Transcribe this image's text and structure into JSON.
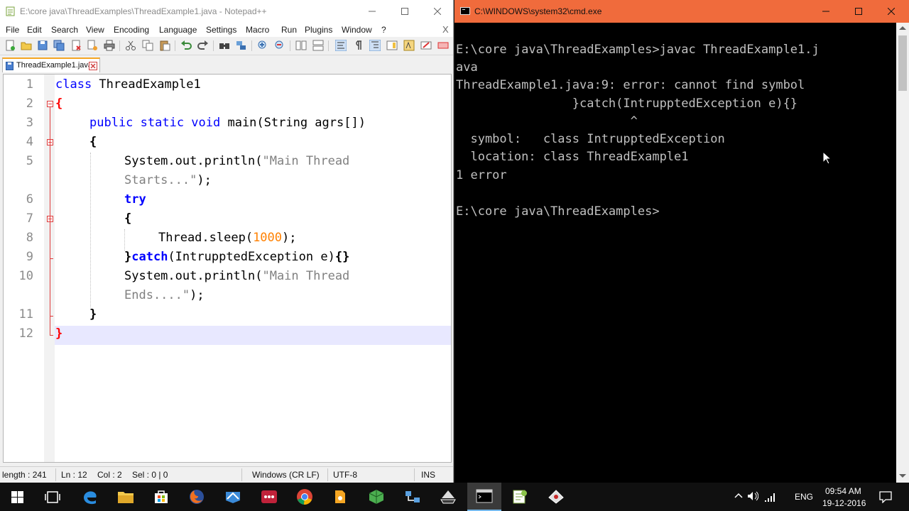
{
  "notepad": {
    "title": "E:\\core java\\ThreadExamples\\ThreadExample1.java - Notepad++",
    "menu": [
      "File",
      "Edit",
      "Search",
      "View",
      "Encoding",
      "Language",
      "Settings",
      "Macro",
      "Run",
      "Plugins",
      "Window",
      "?"
    ],
    "menu_close": "X",
    "tab_label": "ThreadExample1.java",
    "line_numbers": [
      "1",
      "2",
      "3",
      "4",
      "5",
      "6",
      "7",
      "8",
      "9",
      "10",
      "11",
      "12"
    ],
    "code": {
      "l1_kw": "class",
      "l1_name": " ThreadExample1",
      "l2_brace": "{",
      "l3_kw": "public static void",
      "l3_rest": " main(String agrs[])",
      "l4_brace": "{",
      "l5_call": "System.out.println(",
      "l5_str": "\"Main Thread",
      "l5b_str": "Starts...\"",
      "l5b_end": ");",
      "l6_kw": "try",
      "l7_brace": "{",
      "l8_call": "Thread.sleep(",
      "l8_num": "1000",
      "l8_end": ");",
      "l9_brace": "}",
      "l9_kw": "catch",
      "l9_rest": "(IntrupptedException e)",
      "l9_braces": "{}",
      "l10_call": "System.out.println(",
      "l10_str": "\"Main Thread",
      "l10b_str": "Ends....\"",
      "l10b_end": ");",
      "l11_brace": "}",
      "l12_brace": "}"
    },
    "status": {
      "length": "length : 241",
      "ln": "Ln : 12",
      "col": "Col : 2",
      "sel": "Sel : 0 | 0",
      "eol": "Windows (CR LF)",
      "encoding": "UTF-8",
      "mode": "INS"
    }
  },
  "cmd": {
    "title": "C:\\WINDOWS\\system32\\cmd.exe",
    "lines": [
      "E:\\core java\\ThreadExamples>javac ThreadExample1.j",
      "ava",
      "ThreadExample1.java:9: error: cannot find symbol",
      "                }catch(IntrupptedException e){}",
      "                        ^",
      "  symbol:   class IntrupptedException",
      "  location: class ThreadExample1",
      "1 error",
      "",
      "E:\\core java\\ThreadExamples>"
    ]
  },
  "taskbar": {
    "language": "ENG",
    "time": "09:54 AM",
    "date": "19-12-2016"
  },
  "colors": {
    "cmd_title_bar": "#f06b3c",
    "keyword": "#0000ff",
    "string": "#808080",
    "number": "#ff8000",
    "fold_marker": "#e03c3c"
  }
}
